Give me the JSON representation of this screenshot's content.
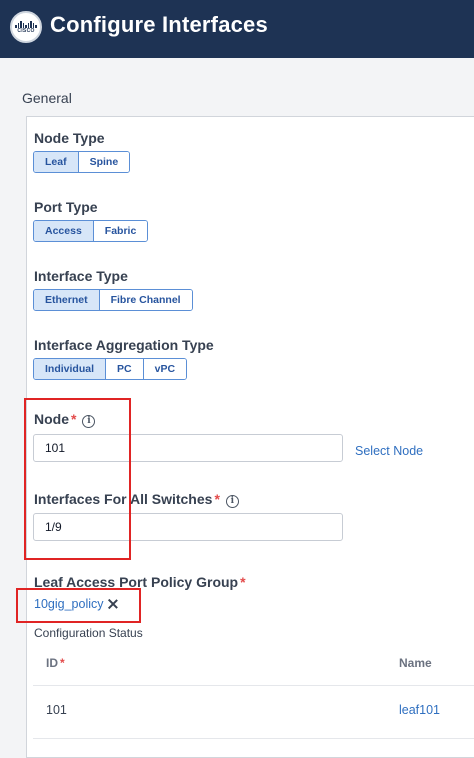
{
  "header": {
    "title": "Configure Interfaces",
    "logo_text": "CISCO"
  },
  "general": {
    "section_title": "General",
    "node_type": {
      "label": "Node Type",
      "options": [
        "Leaf",
        "Spine"
      ],
      "selected": "Leaf"
    },
    "port_type": {
      "label": "Port Type",
      "options": [
        "Access",
        "Fabric"
      ],
      "selected": "Access"
    },
    "interface_type": {
      "label": "Interface Type",
      "options": [
        "Ethernet",
        "Fibre Channel"
      ],
      "selected": "Ethernet"
    },
    "aggregation_type": {
      "label": "Interface Aggregation Type",
      "options": [
        "Individual",
        "PC",
        "vPC"
      ],
      "selected": "Individual"
    },
    "node": {
      "label": "Node",
      "required_mark": "*",
      "info_icon": "info-icon",
      "value": "101",
      "select_link": "Select Node"
    },
    "interfaces": {
      "label": "Interfaces For All Switches",
      "required_mark": "*",
      "info_icon": "info-icon",
      "value": "1/9"
    },
    "policy_group": {
      "label": "Leaf Access Port Policy Group",
      "required_mark": "*",
      "value": "10gig_policy",
      "clear_icon": "close-icon"
    },
    "config_status": {
      "label": "Configuration Status",
      "columns": [
        {
          "name": "ID",
          "required_mark": "*"
        },
        {
          "name": "Name"
        }
      ],
      "rows": [
        {
          "id": "101",
          "name": "leaf101"
        }
      ]
    }
  },
  "colors": {
    "header_bg": "#1e3354",
    "accent": "#2f6fc0",
    "annotation_red": "#e02424",
    "selected_segment": "#d7e6f8"
  }
}
